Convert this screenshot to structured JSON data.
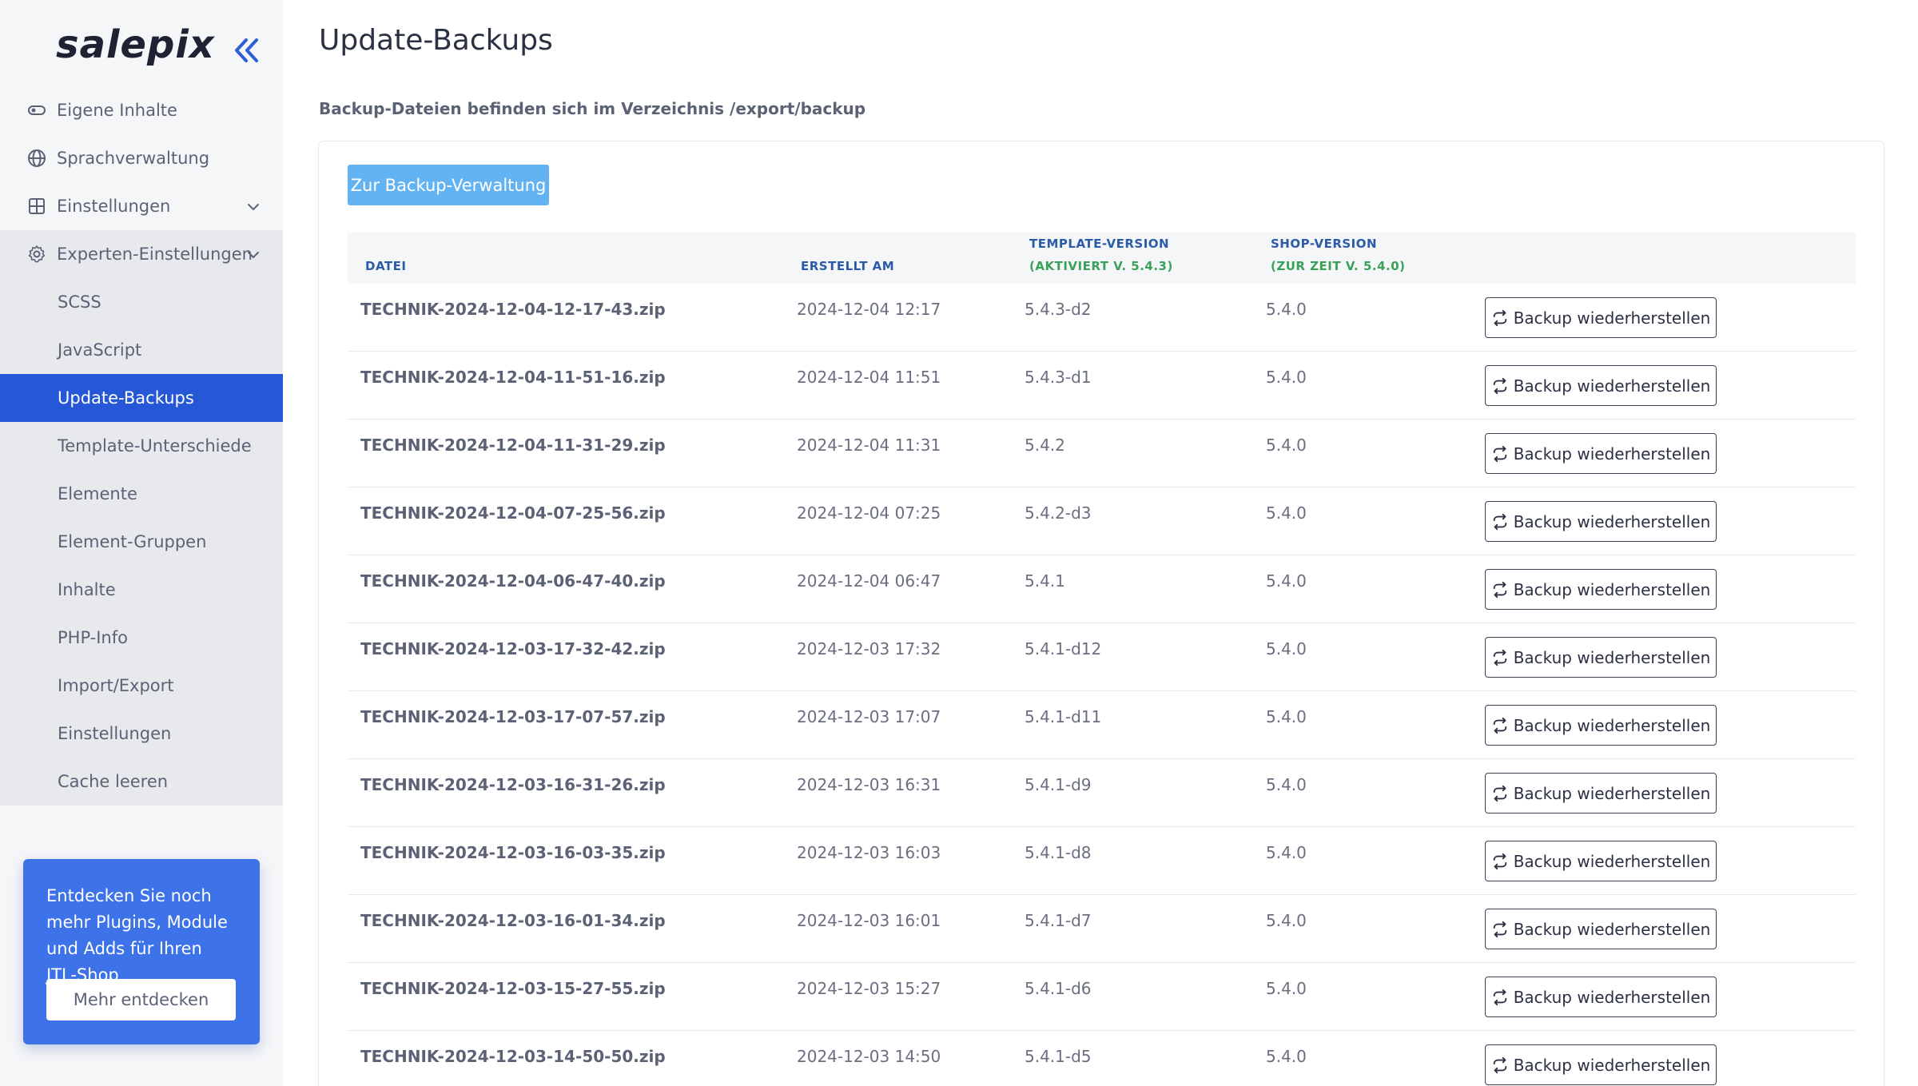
{
  "brand": {
    "logo": "salepix"
  },
  "sidebar": {
    "items": [
      {
        "label": "Eigene Inhalte",
        "icon": "toggle-icon"
      },
      {
        "label": "Sprachverwaltung",
        "icon": "globe-icon"
      },
      {
        "label": "Einstellungen",
        "icon": "grid-icon"
      },
      {
        "label": "Experten-Einstellungen",
        "icon": "gear-icon"
      }
    ],
    "subitems": [
      {
        "label": "SCSS"
      },
      {
        "label": "JavaScript"
      },
      {
        "label": "Update-Backups",
        "active": true
      },
      {
        "label": "Template-Unterschiede"
      },
      {
        "label": "Elemente"
      },
      {
        "label": "Element-Gruppen"
      },
      {
        "label": "Inhalte"
      },
      {
        "label": "PHP-Info"
      },
      {
        "label": "Import/Export"
      },
      {
        "label": "Einstellungen"
      },
      {
        "label": "Cache leeren"
      }
    ],
    "promo": {
      "text": "Entdecken Sie noch mehr Plugins, Module und Adds für Ihren JTL-Shop",
      "button": "Mehr entdecken"
    }
  },
  "main": {
    "title": "Update-Backups",
    "subtitle": "Backup-Dateien befinden sich im Verzeichnis /export/backup",
    "mgmt_button": "Zur Backup-Verwaltung",
    "table": {
      "headers": {
        "file": "DATEI",
        "created": "ERSTELLT AM",
        "template": "TEMPLATE-VERSION",
        "template_sub": "(AKTIVIERT V. 5.4.3)",
        "shop": "SHOP-VERSION",
        "shop_sub": "(ZUR ZEIT V. 5.4.0)"
      },
      "restore_label": "Backup wiederherstellen",
      "rows": [
        {
          "file": "TECHNIK-2024-12-04-12-17-43.zip",
          "created": "2024-12-04 12:17",
          "template": "5.4.3-d2",
          "shop": "5.4.0"
        },
        {
          "file": "TECHNIK-2024-12-04-11-51-16.zip",
          "created": "2024-12-04 11:51",
          "template": "5.4.3-d1",
          "shop": "5.4.0"
        },
        {
          "file": "TECHNIK-2024-12-04-11-31-29.zip",
          "created": "2024-12-04 11:31",
          "template": "5.4.2",
          "shop": "5.4.0"
        },
        {
          "file": "TECHNIK-2024-12-04-07-25-56.zip",
          "created": "2024-12-04 07:25",
          "template": "5.4.2-d3",
          "shop": "5.4.0"
        },
        {
          "file": "TECHNIK-2024-12-04-06-47-40.zip",
          "created": "2024-12-04 06:47",
          "template": "5.4.1",
          "shop": "5.4.0"
        },
        {
          "file": "TECHNIK-2024-12-03-17-32-42.zip",
          "created": "2024-12-03 17:32",
          "template": "5.4.1-d12",
          "shop": "5.4.0"
        },
        {
          "file": "TECHNIK-2024-12-03-17-07-57.zip",
          "created": "2024-12-03 17:07",
          "template": "5.4.1-d11",
          "shop": "5.4.0"
        },
        {
          "file": "TECHNIK-2024-12-03-16-31-26.zip",
          "created": "2024-12-03 16:31",
          "template": "5.4.1-d9",
          "shop": "5.4.0"
        },
        {
          "file": "TECHNIK-2024-12-03-16-03-35.zip",
          "created": "2024-12-03 16:03",
          "template": "5.4.1-d8",
          "shop": "5.4.0"
        },
        {
          "file": "TECHNIK-2024-12-03-16-01-34.zip",
          "created": "2024-12-03 16:01",
          "template": "5.4.1-d7",
          "shop": "5.4.0"
        },
        {
          "file": "TECHNIK-2024-12-03-15-27-55.zip",
          "created": "2024-12-03 15:27",
          "template": "5.4.1-d6",
          "shop": "5.4.0"
        },
        {
          "file": "TECHNIK-2024-12-03-14-50-50.zip",
          "created": "2024-12-03 14:50",
          "template": "5.4.1-d5",
          "shop": "5.4.0"
        }
      ]
    }
  },
  "colors": {
    "accent": "#2557d6",
    "button_light": "#63b3f2",
    "header_blue": "#2b5ba8",
    "header_green": "#3aa05a"
  }
}
